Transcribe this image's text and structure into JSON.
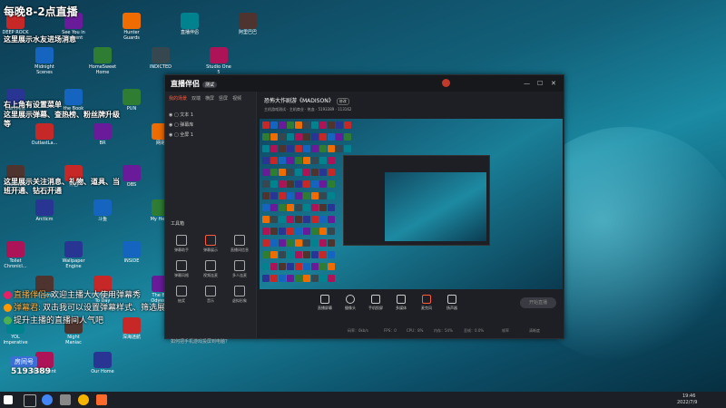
{
  "overlay": {
    "schedule": "每晚8-2点直播",
    "notice1": "这里展示水友进场消息",
    "notice2": "右上角有设置菜单",
    "notice3": "这里展示弹幕、查热榜、粉丝牌升级等",
    "notice4": "这里展示关注消息、礼物、道具、当班开通、钻石开通",
    "room_label": "房间号",
    "room_number": "5193389"
  },
  "chat": [
    {
      "name": "直播伴侣:",
      "text": "欢迎主播大大使用弹幕秀"
    },
    {
      "name": "弹幕君:",
      "text": "双击我可以设置弹幕样式、筛选展示哦"
    },
    {
      "name": "",
      "text": "提升主播的直播间人气吧"
    }
  ],
  "desktop": {
    "icons": [
      "DEEP ROCK",
      "Midnight Scenes",
      "See You in Descent",
      "HomeSweet Home",
      "Hunter Guards",
      "INDICTED",
      "直播伴侣",
      "Studio One 5",
      "阿里巴巴",
      "DarkMist",
      "OutlastLa...",
      "the Book",
      "BR",
      "PUN",
      "网易",
      "360",
      "Steam",
      "TheyAreM...",
      "TheGhost",
      "Arcticm",
      "伴侣",
      "斗鱼",
      "OBS",
      "My Heart",
      "Omnicide",
      "迅雷",
      "SMS",
      "Toilet Chronicl...",
      "Gardenia",
      "Wallpaper Engine",
      "From Day To Day",
      "INSIDE",
      "The Big Odyssey",
      "QQ",
      "谷歌工具",
      "HELLSEED Demo",
      "YOL Imperative",
      "Pentiment",
      "Night Maniac",
      "Our Home",
      "深海迷航"
    ]
  },
  "app": {
    "title": "直播伴侣",
    "badge": "测试",
    "left_tabs": [
      "我的场景",
      "双端",
      "横屏",
      "竖屏",
      "视频"
    ],
    "scenes": [
      "文本 1",
      "弹幕库",
      "全屏 1"
    ],
    "tools_title": "工具箱",
    "tools": [
      "弹幕助手",
      "弹幕展示",
      "直播间信息",
      "弹幕风格",
      "视频连麦",
      "多人连麦",
      "抽奖",
      "音乐",
      "虚拟形象"
    ],
    "tip": "如何把手机游戏投屏到电脑？",
    "stream_title": "恐怖大作剧游《MADISON》",
    "modify_label": "修改",
    "stream_meta": [
      "主机游戏测试",
      "主机商业",
      "热血",
      "5193389",
      "113162"
    ],
    "bottom_buttons": [
      "直播屏幕",
      "摄像头",
      "手机投屏",
      "多媒体",
      "麦克风",
      "扬声器"
    ],
    "go_live": "开始直播",
    "status": [
      "码率：0kb/s",
      "FPS：0",
      "CPU：8%",
      "内存：54%",
      "丢帧：0.0%",
      "帧率",
      "清晰度"
    ]
  },
  "taskbar": {
    "time": "19:46",
    "date": "2022/7/9"
  }
}
